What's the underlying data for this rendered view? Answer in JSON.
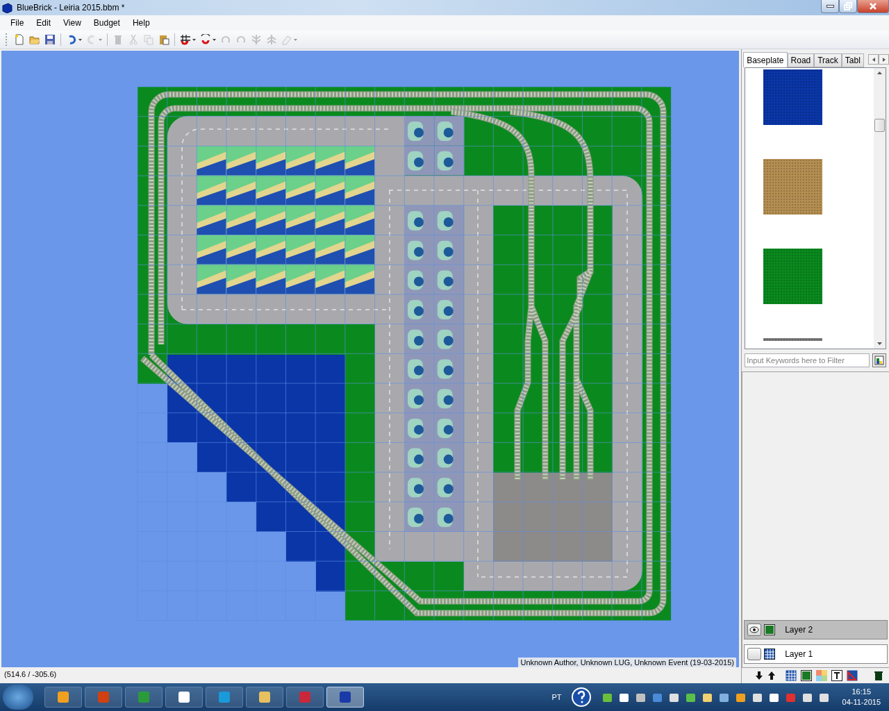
{
  "window": {
    "title": "BlueBrick - Leiria 2015.bbm *"
  },
  "menu": [
    "File",
    "Edit",
    "View",
    "Budget",
    "Help"
  ],
  "toolbar": [
    [
      {
        "disabled": false,
        "has_menu": false
      },
      {
        "disabled": false,
        "has_menu": false
      },
      {
        "disabled": false,
        "has_menu": false
      }
    ],
    [
      {
        "disabled": false,
        "has_menu": true
      },
      {
        "disabled": true,
        "has_menu": true
      }
    ],
    [
      {
        "disabled": true,
        "has_menu": false
      },
      {
        "disabled": true,
        "has_menu": false
      },
      {
        "disabled": true,
        "has_menu": false
      },
      {
        "disabled": false,
        "has_menu": false
      }
    ],
    [
      {
        "disabled": false,
        "has_menu": true
      },
      {
        "disabled": false,
        "has_menu": true
      },
      {
        "disabled": true,
        "has_menu": false
      },
      {
        "disabled": true,
        "has_menu": false
      },
      {
        "disabled": true,
        "has_menu": false
      },
      {
        "disabled": true,
        "has_menu": false
      },
      {
        "disabled": true,
        "has_menu": true
      }
    ]
  ],
  "canvas": {
    "info": "Unknown Author, Unknown LUG, Unknown Event (19-03-2015)"
  },
  "status_bar": {
    "coordinates": "(514.6 / -305.6)"
  },
  "part_tabs": [
    {
      "label": "Baseplate",
      "selected": true
    },
    {
      "label": "Road",
      "selected": false
    },
    {
      "label": "Track",
      "selected": false
    },
    {
      "label": "Tabl",
      "selected": false
    }
  ],
  "parts": [
    {
      "color": "#0a36a8"
    },
    {
      "color": "#b48f52"
    },
    {
      "color": "#0a8a1e"
    },
    {
      "color": "#7a7a7a"
    }
  ],
  "filter": {
    "placeholder": "Input Keywords here to Filter"
  },
  "layers": [
    {
      "name": "Layer 2",
      "kind": "area",
      "selected": true,
      "visible": true
    },
    {
      "name": "Layer 1",
      "kind": "grid",
      "selected": false,
      "visible": false
    }
  ],
  "taskbar": {
    "apps": [
      {
        "selected": false
      },
      {
        "selected": false
      },
      {
        "selected": false
      },
      {
        "selected": false
      },
      {
        "selected": false
      },
      {
        "selected": false
      },
      {
        "selected": false
      },
      {
        "selected": true
      }
    ],
    "language": "PT",
    "time": "16:15",
    "date": "04-11-2015"
  }
}
